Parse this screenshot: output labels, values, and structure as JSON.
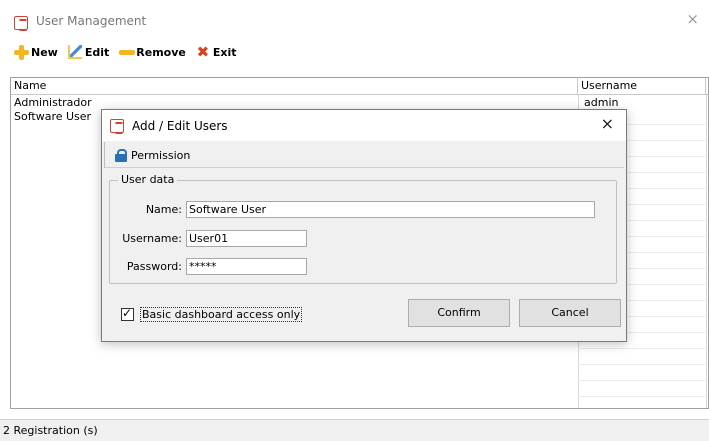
{
  "window": {
    "title": "User Management",
    "close_glyph": "×"
  },
  "toolbar": {
    "new_label": "New",
    "edit_label": "Edit",
    "remove_label": "Remove",
    "exit_label": "Exit"
  },
  "grid": {
    "columns": [
      "Name",
      "Username"
    ],
    "rows": [
      {
        "name": "Administrador",
        "username": "admin"
      },
      {
        "name": "Software User",
        "username": ""
      }
    ]
  },
  "status": {
    "text": "2 Registration (s)"
  },
  "dialog": {
    "title": "Add / Edit Users",
    "close_glyph": "×",
    "tab_label": "Permission",
    "group_label": "User data",
    "name_label": "Name:",
    "name_value": "Software User",
    "username_label": "Username:",
    "username_value": "User01",
    "password_label": "Password:",
    "password_value": "*****",
    "checkbox_label": "Basic dashboard access only",
    "checkbox_checked": true,
    "check_glyph": "✓",
    "confirm_label": "Confirm",
    "cancel_label": "Cancel"
  },
  "icons": {
    "app": "app-logo-icon",
    "new": "plus-icon",
    "edit": "pencil-icon",
    "remove": "minus-icon",
    "exit": "x-icon",
    "tab": "lock-icon"
  },
  "colors": {
    "accent_orange": "#f2b524",
    "exit_red": "#d9431e",
    "lock_blue": "#2a6fb8",
    "dialog_bg": "#f0f0f0"
  }
}
